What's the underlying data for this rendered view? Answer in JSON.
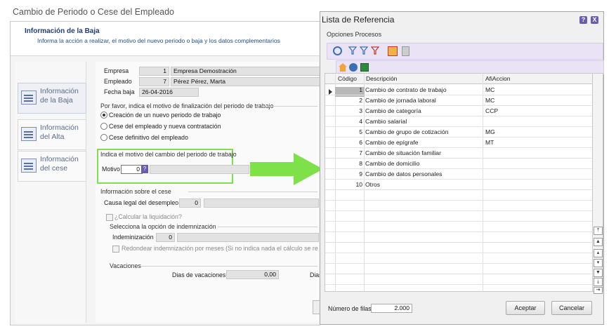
{
  "window_title": "Cambio de Periodo o Cese del Empleado",
  "info_header": {
    "title": "Información de la Baja",
    "subtitle": "Informa la acción a realizar, el motivo del nuevo periodo o baja y los datos complementarios"
  },
  "nav": [
    {
      "line1": "Información",
      "line2": "de la Baja"
    },
    {
      "line1": "Información",
      "line2": "del Alta"
    },
    {
      "line1": "Información",
      "line2": "del cese"
    }
  ],
  "empresa": {
    "label": "Empresa",
    "code": "1",
    "name": "Empresa Demostración"
  },
  "empleado": {
    "label": "Empleado",
    "code": "7",
    "name": "Pérez Pérez, Marta"
  },
  "fecha_baja": {
    "label": "Fecha baja",
    "value": "26-04-2016"
  },
  "motivo_group": {
    "title": "Por favor, indica el motivo de finalización del periodo de trabajo",
    "options": [
      "Creación de un nuevo periodo de trabajo",
      "Cese del empleado y nueva contratación",
      "Cese definitivo del empleado"
    ]
  },
  "motivo_cambio": {
    "title": "Indica el motivo del cambio del periodo de trabajo",
    "label": "Motivo",
    "value": "0"
  },
  "cese": {
    "title": "Información sobre el cese",
    "causa_label": "Causa legal del desempleo",
    "causa_value": "0",
    "calc_label": "¿Calcular la liquidación?",
    "indem_group": "Selecciona la opción de indemnización",
    "indem_label": "Indeminización",
    "indem_value": "0",
    "redondear_label": "Redondear indemnización por meses (Si no indica nada el cálculo se realizará p"
  },
  "vacaciones": {
    "title": "Vacaciones",
    "label": "Dias de vacaciones",
    "value": "0,00",
    "trunc_label": "Dias"
  },
  "dialog": {
    "title": "Lista de Referencia",
    "help": "?",
    "close": "X",
    "menu": [
      "Opciones",
      "Procesos"
    ],
    "columns": [
      "Código",
      "Descripción",
      "AfiAccion"
    ],
    "rows": [
      {
        "code": "1",
        "desc": "Cambio de contrato de trabajo",
        "acc": "MC"
      },
      {
        "code": "2",
        "desc": "Cambio de jornada laboral",
        "acc": "MC"
      },
      {
        "code": "3",
        "desc": "Cambio de categoría",
        "acc": "CCP"
      },
      {
        "code": "4",
        "desc": "Cambio salarial",
        "acc": ""
      },
      {
        "code": "5",
        "desc": "Cambio de grupo de cotización",
        "acc": "MG"
      },
      {
        "code": "6",
        "desc": "Cambio de epígrafe",
        "acc": "MT"
      },
      {
        "code": "7",
        "desc": "Cambio de situación familiar",
        "acc": ""
      },
      {
        "code": "8",
        "desc": "Cambio de domicilio",
        "acc": ""
      },
      {
        "code": "9",
        "desc": "Cambio de datos personales",
        "acc": ""
      },
      {
        "code": "10",
        "desc": "Otros",
        "acc": ""
      }
    ],
    "rows_label": "Número de filas:",
    "rows_value": "2.000",
    "accept": "Aceptar",
    "cancel": "Cancelar"
  },
  "colors": {
    "accent_green": "#7fe14a",
    "title_blue": "#1f3f73",
    "toolbar": "#eae3f6"
  }
}
